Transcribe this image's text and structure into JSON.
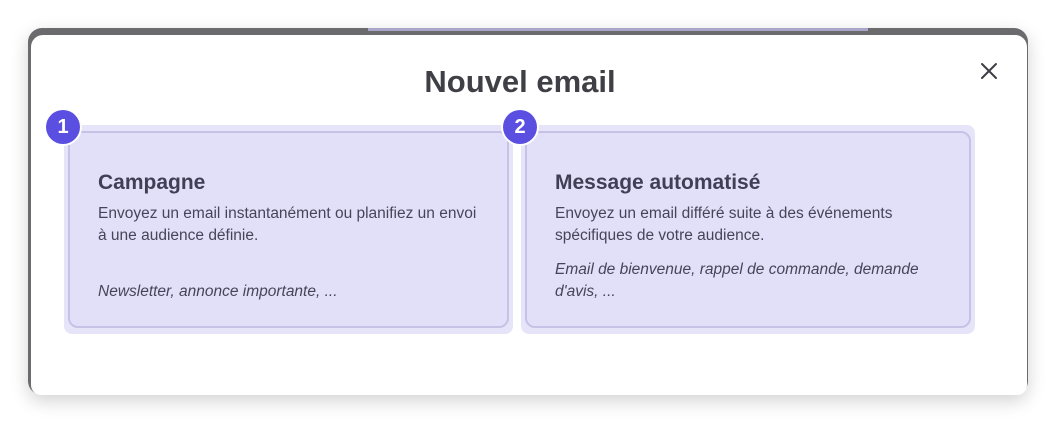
{
  "modal": {
    "title": "Nouvel email",
    "close_icon": "close-icon"
  },
  "options": [
    {
      "badge": "1",
      "title": "Campagne",
      "description": "Envoyez un email instantanément ou planifiez un envoi à une audience définie.",
      "example": "Newsletter, annonce importante, ..."
    },
    {
      "badge": "2",
      "title": "Message automatisé",
      "description": "Envoyez un email différé suite à des événements spécifiques de votre audience.",
      "example": "Email de bienvenue, rappel de commande, demande d'avis, ..."
    }
  ],
  "colors": {
    "badge": "#5b4fe2",
    "card_background": "#e2e0f9",
    "card_border": "#c6c2e6",
    "title_text": "#3f3f46",
    "overlay": "#6b6b6e"
  }
}
